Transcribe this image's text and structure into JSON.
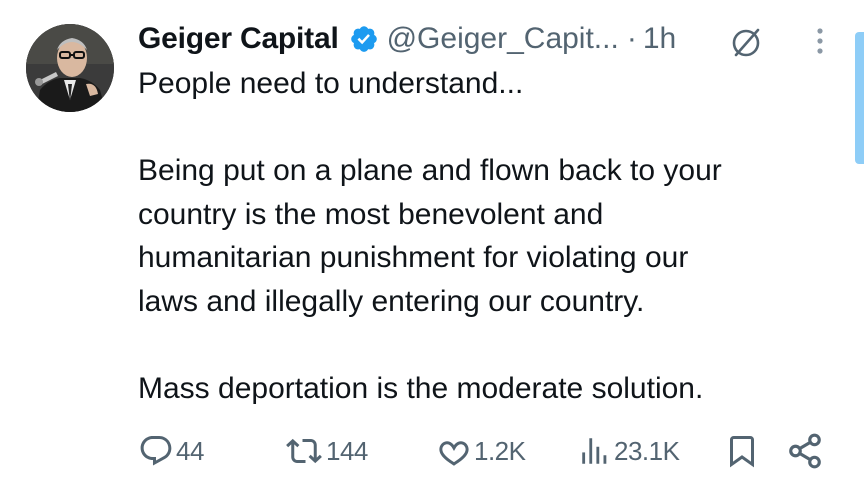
{
  "author": {
    "display_name": "Geiger Capital",
    "handle": "@Geiger_Capit...",
    "separator": "·",
    "time": "1h",
    "verified": true,
    "verified_color": "#1d9bf0"
  },
  "tweet": {
    "paragraphs": [
      "People need to understand...",
      "Being put on a plane and flown back to your\ncountry is the most benevolent and\nhumanitarian punishment for violating our\nlaws and illegally entering our country.",
      "Mass deportation is the moderate solution."
    ]
  },
  "actions": {
    "replies": "44",
    "reposts": "144",
    "likes": "1.2K",
    "views": "23.1K"
  },
  "icons": {
    "reply": "speech-bubble-icon",
    "repost": "repost-arrows-icon",
    "like": "heart-icon",
    "views": "bar-chart-icon",
    "bookmark": "bookmark-icon",
    "share": "share-icon",
    "grok": "grok-icon",
    "more": "vertical-ellipsis-icon"
  },
  "colors": {
    "text": "#0f1419",
    "secondary": "#536471",
    "accent": "#1d9bf0"
  }
}
